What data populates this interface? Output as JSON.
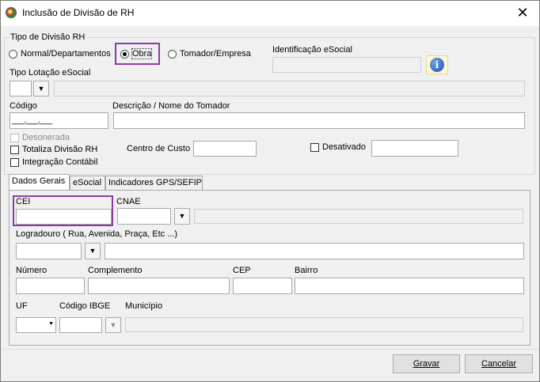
{
  "window": {
    "title": "Inclusão de Divisão de RH",
    "close_glyph": "✕"
  },
  "tipo_divisao": {
    "legend": "Tipo de Divisão RH",
    "options": [
      {
        "label": "Normal/Departamentos",
        "selected": false
      },
      {
        "label": "Obra",
        "selected": true
      },
      {
        "label": "Tomador/Empresa",
        "selected": false
      }
    ]
  },
  "identificacao_esocial": {
    "label": "Identificação eSocial",
    "value": ""
  },
  "info_icon": {
    "glyph": "i",
    "name": "info-icon"
  },
  "tipo_lotacao": {
    "label": "Tipo Lotação eSocial",
    "value": "",
    "description": ""
  },
  "codigo": {
    "label": "Código",
    "value": "___.___.___"
  },
  "descricao": {
    "label": "Descrição / Nome do Tomador",
    "value": ""
  },
  "desonerada": {
    "label": "Desonerada",
    "checked": false,
    "enabled": false
  },
  "totaliza": {
    "label": "Totaliza Divisão RH",
    "checked": false
  },
  "integracao": {
    "label": "Integração Contábil",
    "checked": false
  },
  "centro_custo": {
    "label": "Centro de Custo",
    "value": ""
  },
  "desativado": {
    "label": "Desativado",
    "checked": false,
    "value": ""
  },
  "tabs": [
    {
      "label": "Dados Gerais",
      "active": true
    },
    {
      "label": "eSocial",
      "active": false
    },
    {
      "label": "Indicadores GPS/SEFIP",
      "active": false
    }
  ],
  "dados_gerais": {
    "cei": {
      "label": "CEI",
      "value": ""
    },
    "cnae": {
      "label": "CNAE",
      "value": "",
      "description": ""
    },
    "logradouro": {
      "label": "Logradouro ( Rua, Avenida, Praça, Etc ...)",
      "type_value": "",
      "value": ""
    },
    "numero": {
      "label": "Número",
      "value": ""
    },
    "complemento": {
      "label": "Complemento",
      "value": ""
    },
    "cep": {
      "label": "CEP",
      "value": ""
    },
    "bairro": {
      "label": "Bairro",
      "value": ""
    },
    "uf": {
      "label": "UF",
      "value": ""
    },
    "codigo_ibge": {
      "label": "Código IBGE",
      "value": ""
    },
    "municipio": {
      "label": "Município",
      "value": ""
    }
  },
  "buttons": {
    "gravar": "Gravar",
    "cancelar": "Cancelar"
  },
  "colors": {
    "highlight": "#8e3aa6",
    "window_bg": "#f0f0f0"
  }
}
